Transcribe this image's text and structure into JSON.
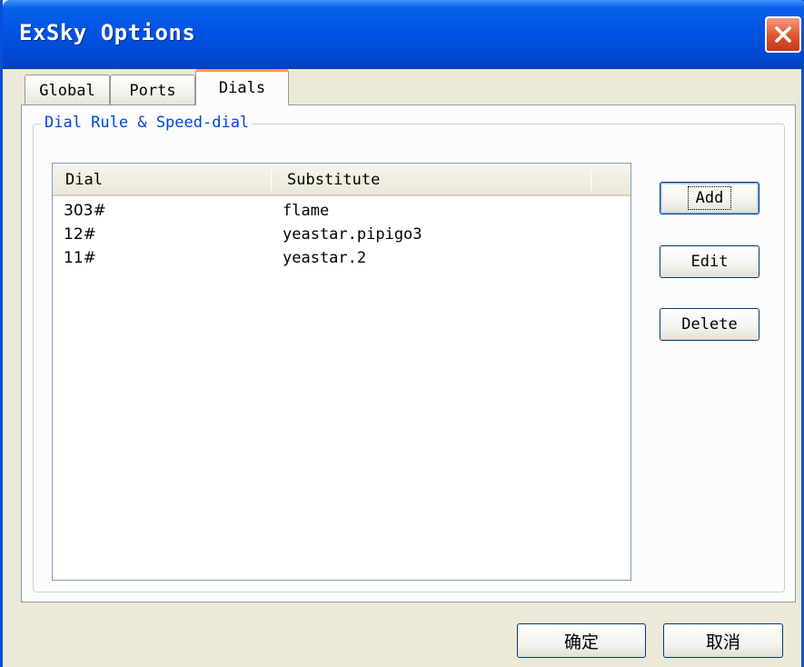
{
  "window": {
    "title": "ExSky Options"
  },
  "tabs": [
    {
      "label": "Global",
      "active": false
    },
    {
      "label": "Ports",
      "active": false
    },
    {
      "label": "Dials",
      "active": true
    }
  ],
  "group": {
    "legend": "Dial Rule & Speed-dial"
  },
  "list": {
    "columns": [
      "Dial",
      "Substitute"
    ],
    "rows": [
      {
        "dial": "303#",
        "substitute": "flame"
      },
      {
        "dial": "12#",
        "substitute": "yeastar.pipigo3"
      },
      {
        "dial": "11#",
        "substitute": "yeastar.2"
      }
    ]
  },
  "side_buttons": {
    "add": "Add",
    "edit": "Edit",
    "delete": "Delete"
  },
  "footer": {
    "ok": "确定",
    "cancel": "取消"
  },
  "colors": {
    "titlebar": "#0054e3",
    "close": "#e0532f",
    "legend": "#0046d5",
    "active_tab_accent": "#ff9a3c"
  },
  "icons": {
    "close": "close-icon"
  }
}
